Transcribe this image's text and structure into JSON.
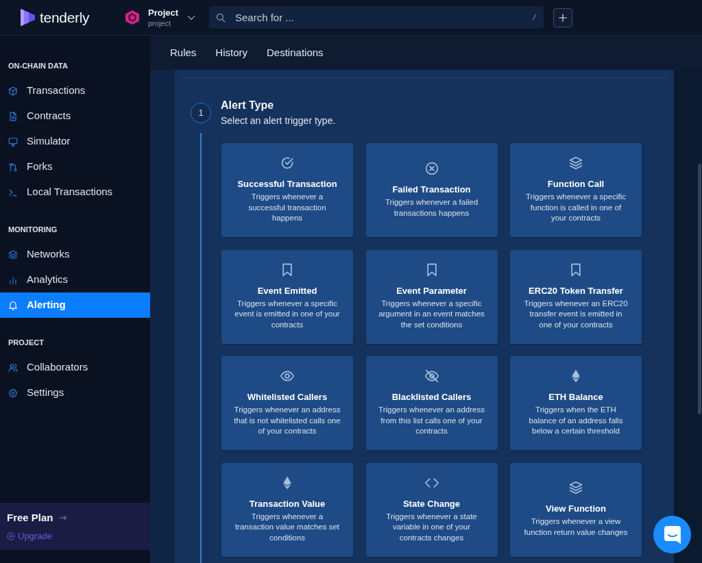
{
  "header": {
    "brand": "tenderly",
    "project": {
      "name": "Project",
      "subtitle": "project"
    },
    "search": {
      "placeholder": "Search for ...",
      "shortcut": "/"
    }
  },
  "sidebar": {
    "sections": [
      {
        "heading": "ON-CHAIN DATA",
        "items": [
          {
            "label": "Transactions",
            "selected": false
          },
          {
            "label": "Contracts",
            "selected": false
          },
          {
            "label": "Simulator",
            "selected": false
          },
          {
            "label": "Forks",
            "selected": false
          },
          {
            "label": "Local Transactions",
            "selected": false
          }
        ]
      },
      {
        "heading": "MONITORING",
        "items": [
          {
            "label": "Networks",
            "selected": false
          },
          {
            "label": "Analytics",
            "selected": false
          },
          {
            "label": "Alerting",
            "selected": true
          }
        ]
      },
      {
        "heading": "PROJECT",
        "items": [
          {
            "label": "Collaborators",
            "selected": false
          },
          {
            "label": "Settings",
            "selected": false
          }
        ]
      }
    ],
    "plan": {
      "name": "Free Plan",
      "action": "Upgrade"
    }
  },
  "tabs": [
    {
      "label": "Rules",
      "selected": false
    },
    {
      "label": "History",
      "selected": false
    },
    {
      "label": "Destinations",
      "selected": false
    }
  ],
  "step": {
    "number": "1",
    "title": "Alert Type",
    "subtitle": "Select an alert trigger type."
  },
  "alert_types": [
    {
      "title": "Successful Transaction",
      "description": "Triggers whenever a successful transaction happens"
    },
    {
      "title": "Failed Transaction",
      "description": "Triggers whenever a failed transactions happens"
    },
    {
      "title": "Function Call",
      "description": "Triggers whenever a specific function is called in one of your contracts"
    },
    {
      "title": "Event Emitted",
      "description": "Triggers whenever a specific event is emitted in one of your contracts"
    },
    {
      "title": "Event Parameter",
      "description": "Triggers whenever a specific argument in an event matches the set conditions"
    },
    {
      "title": "ERC20 Token Transfer",
      "description": "Triggers whenever an ERC20 transfer event is emitted in one of your contracts"
    },
    {
      "title": "Whitelisted Callers",
      "description": "Triggers whenever an address that is not whitelisted calls one of your contracts"
    },
    {
      "title": "Blacklisted Callers",
      "description": "Triggers whenever an address from this list calls one of your contracts"
    },
    {
      "title": "ETH Balance",
      "description": "Triggers when the ETH balance of an address falls below a certain threshold"
    },
    {
      "title": "Transaction Value",
      "description": "Triggers whenever a transaction value matches set conditions"
    },
    {
      "title": "State Change",
      "description": "Triggers whenever a state variable in one of your contracts changes"
    },
    {
      "title": "View Function",
      "description": "Triggers whenever a view function return value changes"
    }
  ]
}
